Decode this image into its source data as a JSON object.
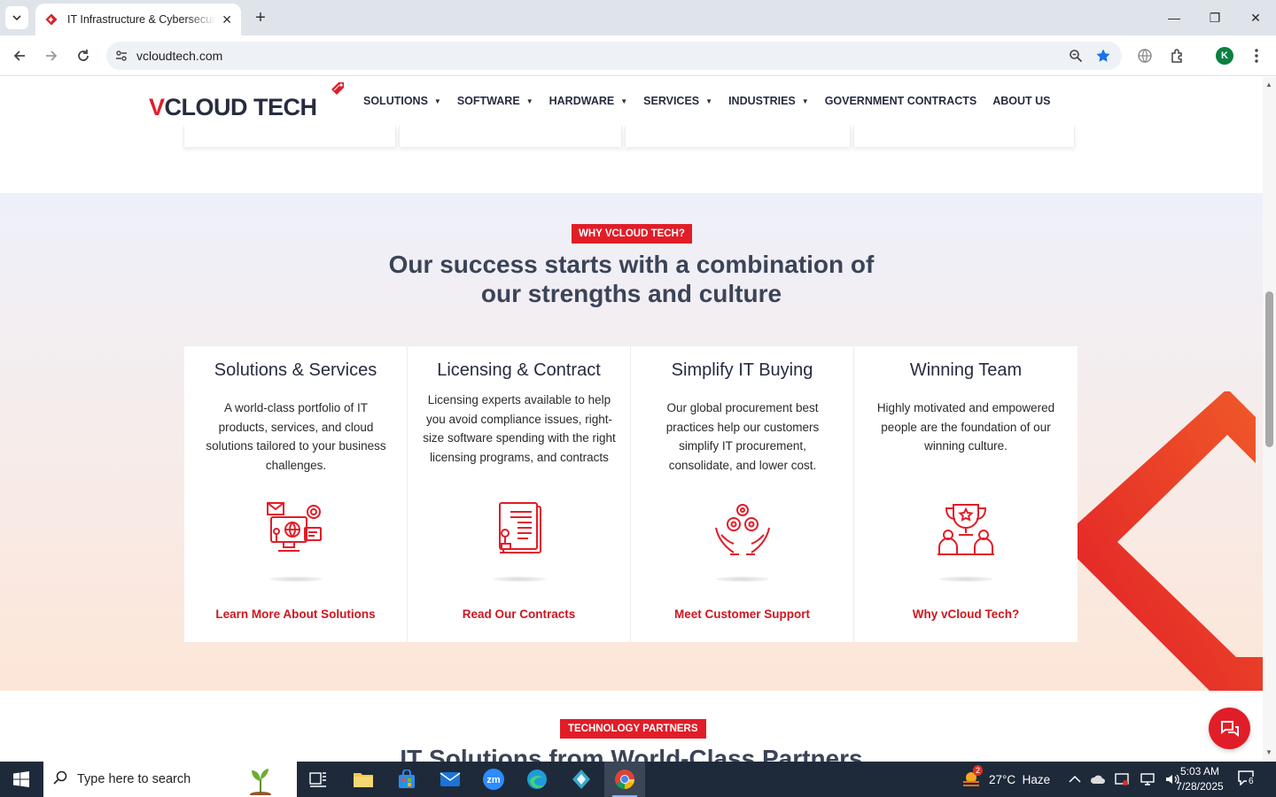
{
  "browser": {
    "tab_title": "IT Infrastructure & Cybersecurity",
    "url": "vcloudtech.com",
    "profile_initial": "K"
  },
  "site": {
    "logo_prefix": "V",
    "logo_main": "CLOUD TECH",
    "nav": [
      {
        "label": "SOLUTIONS",
        "has_caret": true
      },
      {
        "label": "SOFTWARE",
        "has_caret": true
      },
      {
        "label": "HARDWARE",
        "has_caret": true
      },
      {
        "label": "SERVICES",
        "has_caret": true
      },
      {
        "label": "INDUSTRIES",
        "has_caret": true
      },
      {
        "label": "GOVERNMENT CONTRACTS",
        "has_caret": false
      },
      {
        "label": "ABOUT US",
        "has_caret": false
      }
    ]
  },
  "why": {
    "eyebrow": "WHY VCLOUD TECH?",
    "title_line1": "Our success starts with a combination of",
    "title_line2": "our strengths and culture",
    "features": [
      {
        "title": "Solutions & Services",
        "desc": "A world-class portfolio of IT products, services, and cloud solutions tailored to your business challenges.",
        "link": "Learn More About Solutions",
        "icon": "computer-network-icon"
      },
      {
        "title": "Licensing & Contract",
        "desc": "Licensing experts available to help you avoid compliance issues, right-size software spending with the right licensing programs, and contracts",
        "link": "Read Our Contracts",
        "icon": "contract-stamp-icon"
      },
      {
        "title": "Simplify IT Buying",
        "desc": "Our global procurement best practices help our customers simplify IT procurement, consolidate, and lower cost.",
        "link": "Meet Customer Support",
        "icon": "gears-hands-icon"
      },
      {
        "title": "Winning Team",
        "desc": "Highly motivated and empowered people are the foundation of our winning culture.",
        "link": "Why vCloud Tech?",
        "icon": "trophy-team-icon"
      }
    ]
  },
  "partners": {
    "eyebrow": "TECHNOLOGY PARTNERS",
    "title": "IT Solutions from World-Class Partners"
  },
  "taskbar": {
    "search_placeholder": "Type here to search",
    "weather_badge": "2",
    "weather": "27°C  Haze",
    "time": "5:03 AM",
    "date": "7/28/2025",
    "notifications": "6"
  },
  "colors": {
    "brand_red": "#e11d28",
    "navy": "#262c3f"
  }
}
